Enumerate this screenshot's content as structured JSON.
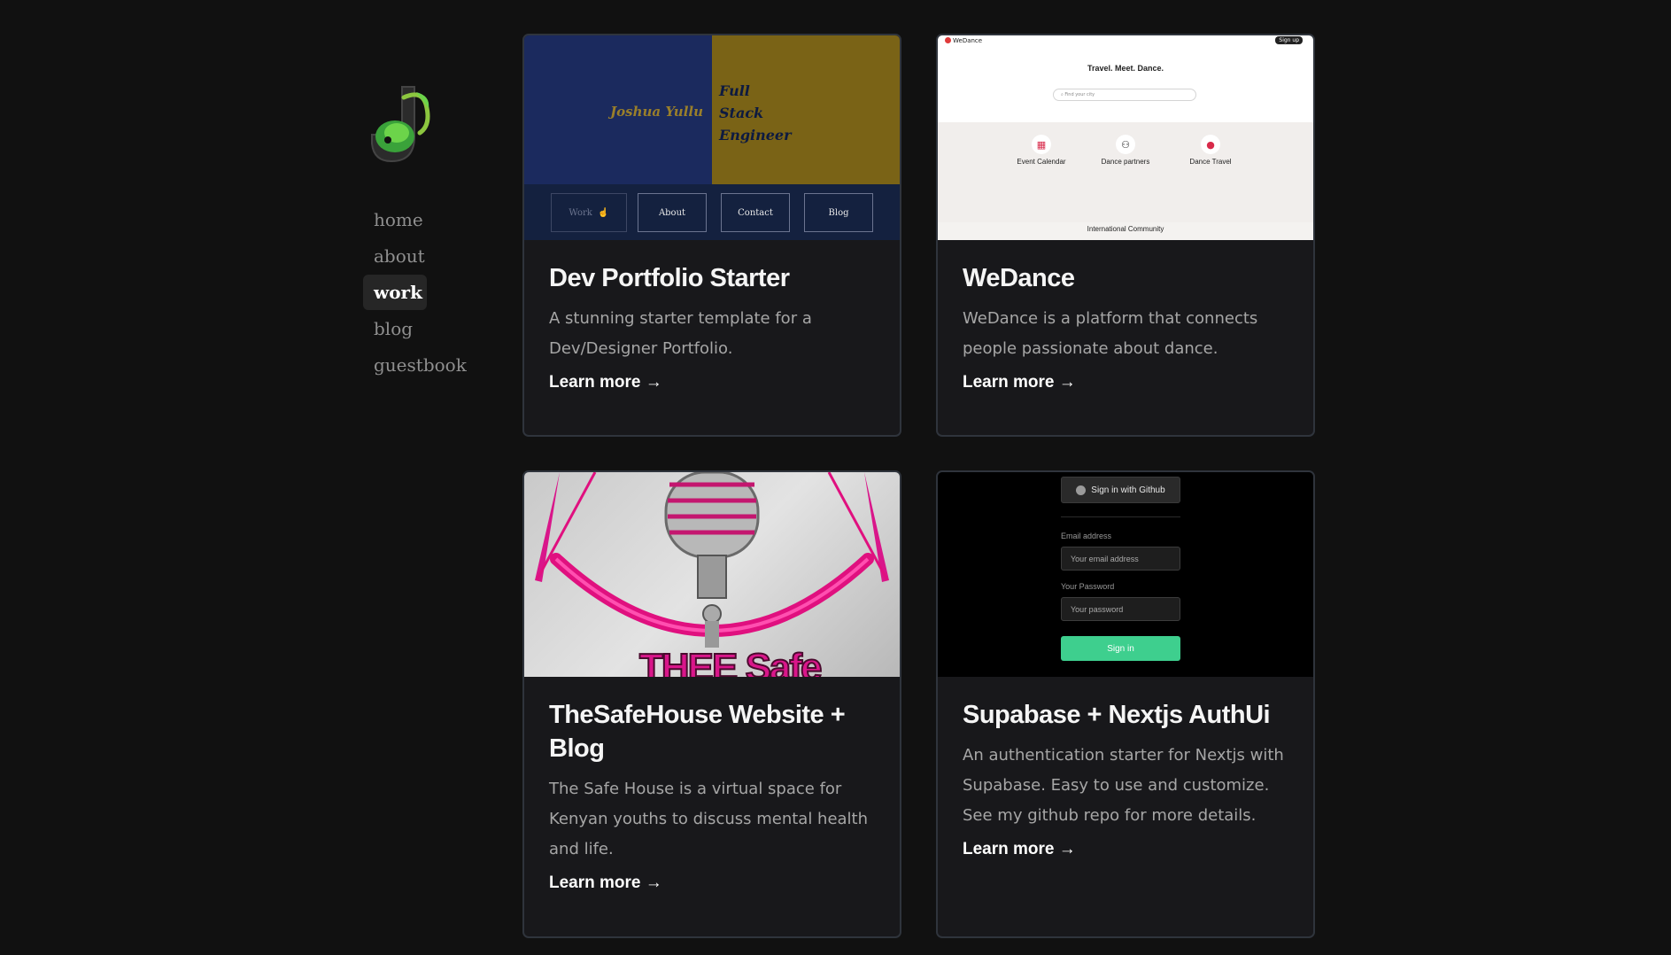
{
  "nav": {
    "items": [
      {
        "label": "home",
        "active": false
      },
      {
        "label": "about",
        "active": false
      },
      {
        "label": "work",
        "active": true
      },
      {
        "label": "blog",
        "active": false
      },
      {
        "label": "guestbook",
        "active": false
      }
    ]
  },
  "cards": [
    {
      "title": "Dev Portfolio Starter",
      "description": "A stunning starter template for a Dev/Designer Portfolio.",
      "link": "Learn more →",
      "preview": {
        "name": "Joshua Yullu",
        "role_lines": [
          "Full",
          "Stack",
          "Engineer"
        ],
        "buttons": [
          "Work",
          "About",
          "Contact",
          "Blog"
        ]
      }
    },
    {
      "title": "WeDance",
      "description": "WeDance is a platform that connects people passionate about dance.",
      "link": "Learn more →",
      "preview": {
        "brand": "WeDance",
        "signup": "Sign up",
        "hero": "Travel. Meet. Dance.",
        "search_placeholder": "Find your city",
        "features": [
          "Event Calendar",
          "Dance partners",
          "Dance Travel"
        ],
        "community": "International Community"
      }
    },
    {
      "title": "TheSafeHouse Website + Blog",
      "description": "The Safe House is a virtual space for Kenyan youths to discuss mental health and life.",
      "link": "Learn more →",
      "preview": {
        "logo_text": "THEE Safe"
      }
    },
    {
      "title": "Supabase + Nextjs AuthUi",
      "description": "An authentication starter for Nextjs with Supabase. Easy to use and customize. See my github repo for more details.",
      "link": "Learn more →",
      "preview": {
        "github_button": "Sign in with Github",
        "email_label": "Email address",
        "email_placeholder": "Your email address",
        "password_label": "Your Password",
        "password_placeholder": "Your password",
        "signin_button": "Sign in"
      }
    }
  ],
  "colors": {
    "background": "#111111",
    "card_bg": "#18181b",
    "card_border": "#2f343c",
    "supabase_green": "#3ecf8e",
    "safehouse_pink": "#e0107f"
  }
}
